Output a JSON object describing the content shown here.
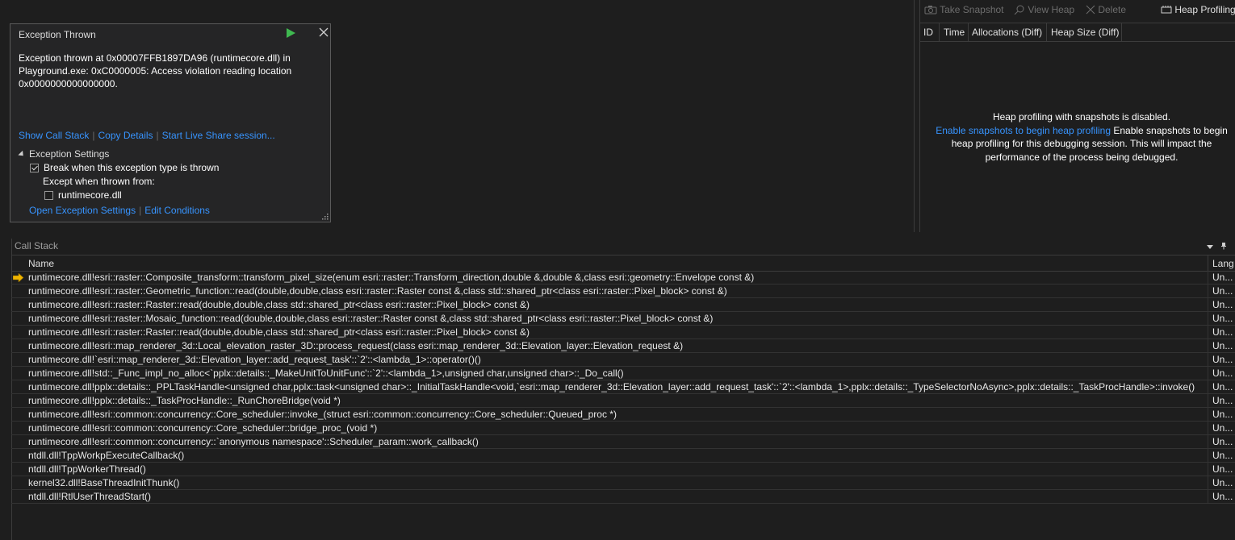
{
  "exception_popup": {
    "title": "Exception Thrown",
    "message": "Exception thrown at 0x00007FFB1897DA96 (runtimecore.dll) in\nPlayground.exe: 0xC0000005: Access violation reading location\n0x0000000000000000.",
    "links": {
      "show_call_stack": "Show Call Stack",
      "copy_details": "Copy Details",
      "live_share": "Start Live Share session..."
    },
    "settings": {
      "header": "Exception Settings",
      "break_label": "Break when this exception type is thrown",
      "break_checked": true,
      "except_label": "Except when thrown from:",
      "module_label": "runtimecore.dll",
      "module_checked": false,
      "open_settings": "Open Exception Settings",
      "edit_conditions": "Edit Conditions"
    }
  },
  "diagnostics": {
    "toolbar": {
      "take_snapshot": "Take Snapshot",
      "view_heap": "View Heap",
      "delete": "Delete",
      "heap_profiling": "Heap Profiling"
    },
    "columns": [
      "ID",
      "Time",
      "Allocations (Diff)",
      "Heap Size (Diff)"
    ],
    "message_line1": "Heap profiling with snapshots is disabled.",
    "enable_link": "Enable snapshots to begin heap profiling",
    "message_rest": " Enable snapshots to begin heap profiling  for this debugging session. This will impact the performance of the process being debugged."
  },
  "call_stack": {
    "title": "Call Stack",
    "columns": {
      "name": "Name",
      "lang": "Lang"
    },
    "frames": [
      {
        "name": "runtimecore.dll!esri::raster::Composite_transform::transform_pixel_size(enum esri::raster::Transform_direction,double &,double &,class esri::geometry::Envelope const &)",
        "lang": "Un...",
        "current": true
      },
      {
        "name": "runtimecore.dll!esri::raster::Geometric_function::read(double,double,class esri::raster::Raster const &,class std::shared_ptr<class esri::raster::Pixel_block> const &)",
        "lang": "Un..."
      },
      {
        "name": "runtimecore.dll!esri::raster::Raster::read(double,double,class std::shared_ptr<class esri::raster::Pixel_block> const &)",
        "lang": "Un..."
      },
      {
        "name": "runtimecore.dll!esri::raster::Mosaic_function::read(double,double,class esri::raster::Raster const &,class std::shared_ptr<class esri::raster::Pixel_block> const &)",
        "lang": "Un..."
      },
      {
        "name": "runtimecore.dll!esri::raster::Raster::read(double,double,class std::shared_ptr<class esri::raster::Pixel_block> const &)",
        "lang": "Un..."
      },
      {
        "name": "runtimecore.dll!esri::map_renderer_3d::Local_elevation_raster_3D::process_request(class esri::map_renderer_3d::Elevation_layer::Elevation_request &)",
        "lang": "Un..."
      },
      {
        "name": "runtimecore.dll!`esri::map_renderer_3d::Elevation_layer::add_request_task'::`2'::<lambda_1>::operator()()",
        "lang": "Un..."
      },
      {
        "name": "runtimecore.dll!std::_Func_impl_no_alloc<`pplx::details::_MakeUnitToUnitFunc'::`2'::<lambda_1>,unsigned char,unsigned char>::_Do_call()",
        "lang": "Un..."
      },
      {
        "name": "runtimecore.dll!pplx::details::_PPLTaskHandle<unsigned char,pplx::task<unsigned char>::_InitialTaskHandle<void,`esri::map_renderer_3d::Elevation_layer::add_request_task'::`2'::<lambda_1>,pplx::details::_TypeSelectorNoAsync>,pplx::details::_TaskProcHandle>::invoke()",
        "lang": "Un..."
      },
      {
        "name": "runtimecore.dll!pplx::details::_TaskProcHandle::_RunChoreBridge(void *)",
        "lang": "Un..."
      },
      {
        "name": "runtimecore.dll!esri::common::concurrency::Core_scheduler::invoke_(struct esri::common::concurrency::Core_scheduler::Queued_proc *)",
        "lang": "Un..."
      },
      {
        "name": "runtimecore.dll!esri::common::concurrency::Core_scheduler::bridge_proc_(void *)",
        "lang": "Un..."
      },
      {
        "name": "runtimecore.dll!esri::common::concurrency::`anonymous namespace'::Scheduler_param::work_callback()",
        "lang": "Un..."
      },
      {
        "name": "ntdll.dll!TppWorkpExecuteCallback()",
        "lang": "Un..."
      },
      {
        "name": "ntdll.dll!TppWorkerThread()",
        "lang": "Un..."
      },
      {
        "name": "kernel32.dll!BaseThreadInitThunk()",
        "lang": "Un..."
      },
      {
        "name": "ntdll.dll!RtlUserThreadStart()",
        "lang": "Un..."
      }
    ]
  },
  "colors": {
    "background": "#1e1e1e",
    "panel": "#252526",
    "link": "#3794ff",
    "play": "#3fb950",
    "current_frame_arrow": "#f0b400"
  }
}
